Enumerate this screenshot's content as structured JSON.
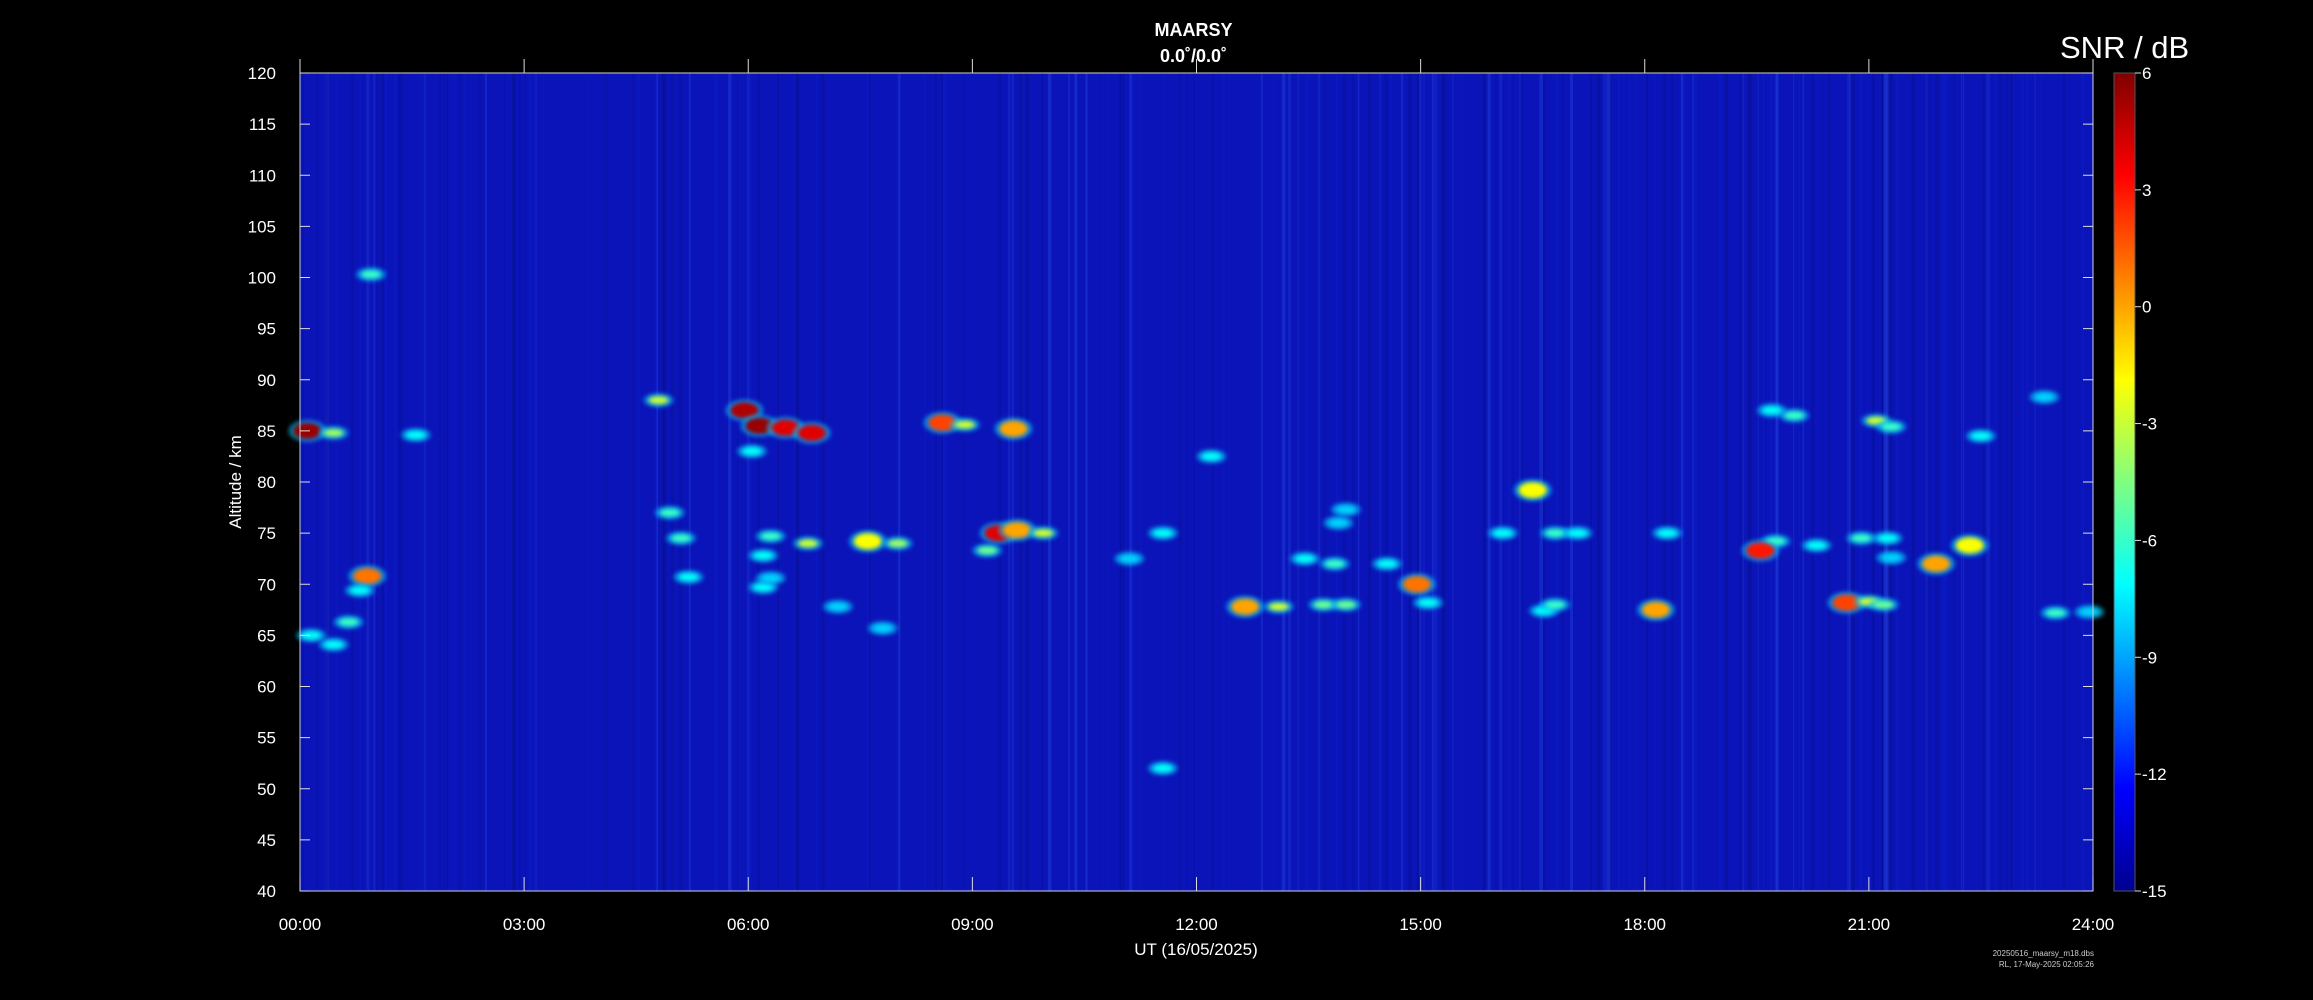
{
  "header": {
    "title": "MAARSY",
    "subtitle": "0.0˚/0.0˚"
  },
  "colorbar": {
    "title": "SNR / dB",
    "ticks": [
      "6",
      "3",
      "0",
      "-3",
      "-6",
      "-9",
      "-12",
      "-15"
    ],
    "range": [
      -15,
      6
    ],
    "colormap": "jet"
  },
  "footer": {
    "line1": "20250516_maarsy_m18.dbs",
    "line2": "RL, 17-May-2025 02:05:26"
  },
  "chart_data": {
    "type": "heatmap",
    "xlabel": "UT (16/05/2025)",
    "ylabel": "Altitude / km",
    "x_ticks": [
      "00:00",
      "03:00",
      "06:00",
      "09:00",
      "12:00",
      "15:00",
      "18:00",
      "21:00",
      "24:00"
    ],
    "xlim": [
      0,
      24
    ],
    "y_ticks": [
      "40",
      "45",
      "50",
      "55",
      "60",
      "65",
      "70",
      "75",
      "80",
      "85",
      "90",
      "95",
      "100",
      "105",
      "110",
      "115",
      "120"
    ],
    "ylim": [
      40,
      120
    ],
    "background_snr": -13,
    "echoes": [
      {
        "t": 0.1,
        "h": 85.0,
        "snr": 5.5
      },
      {
        "t": 0.45,
        "h": 84.8,
        "snr": -4
      },
      {
        "t": 1.55,
        "h": 84.6,
        "snr": -7
      },
      {
        "t": 4.8,
        "h": 88.0,
        "snr": -3
      },
      {
        "t": 5.95,
        "h": 87.0,
        "snr": 5
      },
      {
        "t": 6.15,
        "h": 85.5,
        "snr": 5.5
      },
      {
        "t": 6.5,
        "h": 85.3,
        "snr": 4
      },
      {
        "t": 6.85,
        "h": 84.8,
        "snr": 4
      },
      {
        "t": 8.6,
        "h": 85.8,
        "snr": 2
      },
      {
        "t": 8.9,
        "h": 85.6,
        "snr": -3
      },
      {
        "t": 9.55,
        "h": 85.2,
        "snr": 0
      },
      {
        "t": 6.05,
        "h": 83.0,
        "snr": -7
      },
      {
        "t": 12.2,
        "h": 82.5,
        "snr": -7
      },
      {
        "t": 4.95,
        "h": 77.0,
        "snr": -6
      },
      {
        "t": 5.1,
        "h": 74.5,
        "snr": -6
      },
      {
        "t": 6.3,
        "h": 74.7,
        "snr": -6
      },
      {
        "t": 6.8,
        "h": 74.0,
        "snr": -3
      },
      {
        "t": 7.6,
        "h": 74.2,
        "snr": -2
      },
      {
        "t": 8.0,
        "h": 74.0,
        "snr": -4
      },
      {
        "t": 9.35,
        "h": 75.0,
        "snr": 4
      },
      {
        "t": 9.6,
        "h": 75.3,
        "snr": 0
      },
      {
        "t": 9.95,
        "h": 75.0,
        "snr": -3
      },
      {
        "t": 9.2,
        "h": 73.3,
        "snr": -5
      },
      {
        "t": 6.2,
        "h": 72.8,
        "snr": -7
      },
      {
        "t": 11.55,
        "h": 75.0,
        "snr": -7
      },
      {
        "t": 11.1,
        "h": 72.5,
        "snr": -8
      },
      {
        "t": 13.45,
        "h": 72.5,
        "snr": -7
      },
      {
        "t": 14.0,
        "h": 77.3,
        "snr": -8
      },
      {
        "t": 13.9,
        "h": 76.0,
        "snr": -8
      },
      {
        "t": 13.85,
        "h": 72.0,
        "snr": -6
      },
      {
        "t": 14.55,
        "h": 72.0,
        "snr": -7
      },
      {
        "t": 16.5,
        "h": 79.2,
        "snr": -2
      },
      {
        "t": 16.1,
        "h": 75.0,
        "snr": -7
      },
      {
        "t": 16.8,
        "h": 75.0,
        "snr": -6
      },
      {
        "t": 17.1,
        "h": 75.0,
        "snr": -7
      },
      {
        "t": 18.3,
        "h": 75.0,
        "snr": -7
      },
      {
        "t": 19.75,
        "h": 74.2,
        "snr": -6
      },
      {
        "t": 19.55,
        "h": 73.3,
        "snr": 3
      },
      {
        "t": 20.3,
        "h": 73.8,
        "snr": -7
      },
      {
        "t": 20.9,
        "h": 74.5,
        "snr": -6
      },
      {
        "t": 21.25,
        "h": 74.5,
        "snr": -7
      },
      {
        "t": 21.3,
        "h": 72.6,
        "snr": -8
      },
      {
        "t": 21.9,
        "h": 72.0,
        "snr": 0
      },
      {
        "t": 22.35,
        "h": 73.8,
        "snr": -2
      },
      {
        "t": 21.1,
        "h": 86.0,
        "snr": -3
      },
      {
        "t": 21.3,
        "h": 85.4,
        "snr": -6
      },
      {
        "t": 20.0,
        "h": 86.5,
        "snr": -6
      },
      {
        "t": 19.7,
        "h": 87.0,
        "snr": -7
      },
      {
        "t": 22.5,
        "h": 84.5,
        "snr": -7
      },
      {
        "t": 23.35,
        "h": 88.3,
        "snr": -8
      },
      {
        "t": 5.2,
        "h": 70.7,
        "snr": -7
      },
      {
        "t": 6.2,
        "h": 69.7,
        "snr": -7
      },
      {
        "t": 6.3,
        "h": 70.6,
        "snr": -8
      },
      {
        "t": 0.9,
        "h": 70.8,
        "snr": 1
      },
      {
        "t": 0.8,
        "h": 69.4,
        "snr": -7
      },
      {
        "t": 0.65,
        "h": 66.3,
        "snr": -6
      },
      {
        "t": 0.45,
        "h": 64.1,
        "snr": -7
      },
      {
        "t": 0.15,
        "h": 65.0,
        "snr": -7
      },
      {
        "t": 7.8,
        "h": 65.7,
        "snr": -8
      },
      {
        "t": 7.2,
        "h": 67.8,
        "snr": -8
      },
      {
        "t": 12.65,
        "h": 67.8,
        "snr": 0
      },
      {
        "t": 13.1,
        "h": 67.8,
        "snr": -3
      },
      {
        "t": 13.7,
        "h": 68.0,
        "snr": -5
      },
      {
        "t": 14.0,
        "h": 68.0,
        "snr": -5
      },
      {
        "t": 14.95,
        "h": 70.0,
        "snr": 1
      },
      {
        "t": 15.1,
        "h": 68.2,
        "snr": -7
      },
      {
        "t": 16.65,
        "h": 67.4,
        "snr": -7
      },
      {
        "t": 16.8,
        "h": 68.0,
        "snr": -6
      },
      {
        "t": 18.15,
        "h": 67.5,
        "snr": 0
      },
      {
        "t": 20.7,
        "h": 68.2,
        "snr": 2
      },
      {
        "t": 21.0,
        "h": 68.3,
        "snr": -3
      },
      {
        "t": 21.2,
        "h": 68.0,
        "snr": -5
      },
      {
        "t": 23.5,
        "h": 67.2,
        "snr": -6
      },
      {
        "t": 23.95,
        "h": 67.3,
        "snr": -8
      },
      {
        "t": 11.55,
        "h": 52.0,
        "snr": -7
      },
      {
        "t": 0.95,
        "h": 100.3,
        "snr": -6
      }
    ]
  }
}
